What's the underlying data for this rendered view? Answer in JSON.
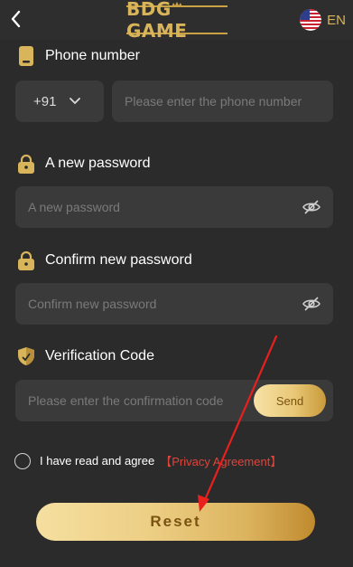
{
  "header": {
    "logo_text": "BDG GAME",
    "language": "EN"
  },
  "form": {
    "phone": {
      "label": "Phone number",
      "country_code": "+91",
      "placeholder": "Please enter the phone number"
    },
    "new_password": {
      "label": "A new password",
      "placeholder": "A new password"
    },
    "confirm_password": {
      "label": "Confirm new password",
      "placeholder": "Confirm new password"
    },
    "verification": {
      "label": "Verification Code",
      "placeholder": "Please enter the confirmation code",
      "send_label": "Send"
    },
    "agree": {
      "text": "I have read and agree",
      "link": "【Privacy Agreement】"
    },
    "reset_label": "Reset"
  },
  "colors": {
    "background": "#2b2b2b",
    "input_bg": "#3a3a3a",
    "gold": "#d8b45a",
    "button_text": "#7a5312",
    "link_red": "#e0443a",
    "annotation_red": "#e8201e"
  },
  "icons": {
    "back": "chevron-left-icon",
    "flag": "us-flag-icon",
    "phone": "phone-icon",
    "lock": "lock-icon",
    "eye": "eye-off-icon",
    "shield": "shield-icon",
    "dropdown": "chevron-down-icon"
  }
}
